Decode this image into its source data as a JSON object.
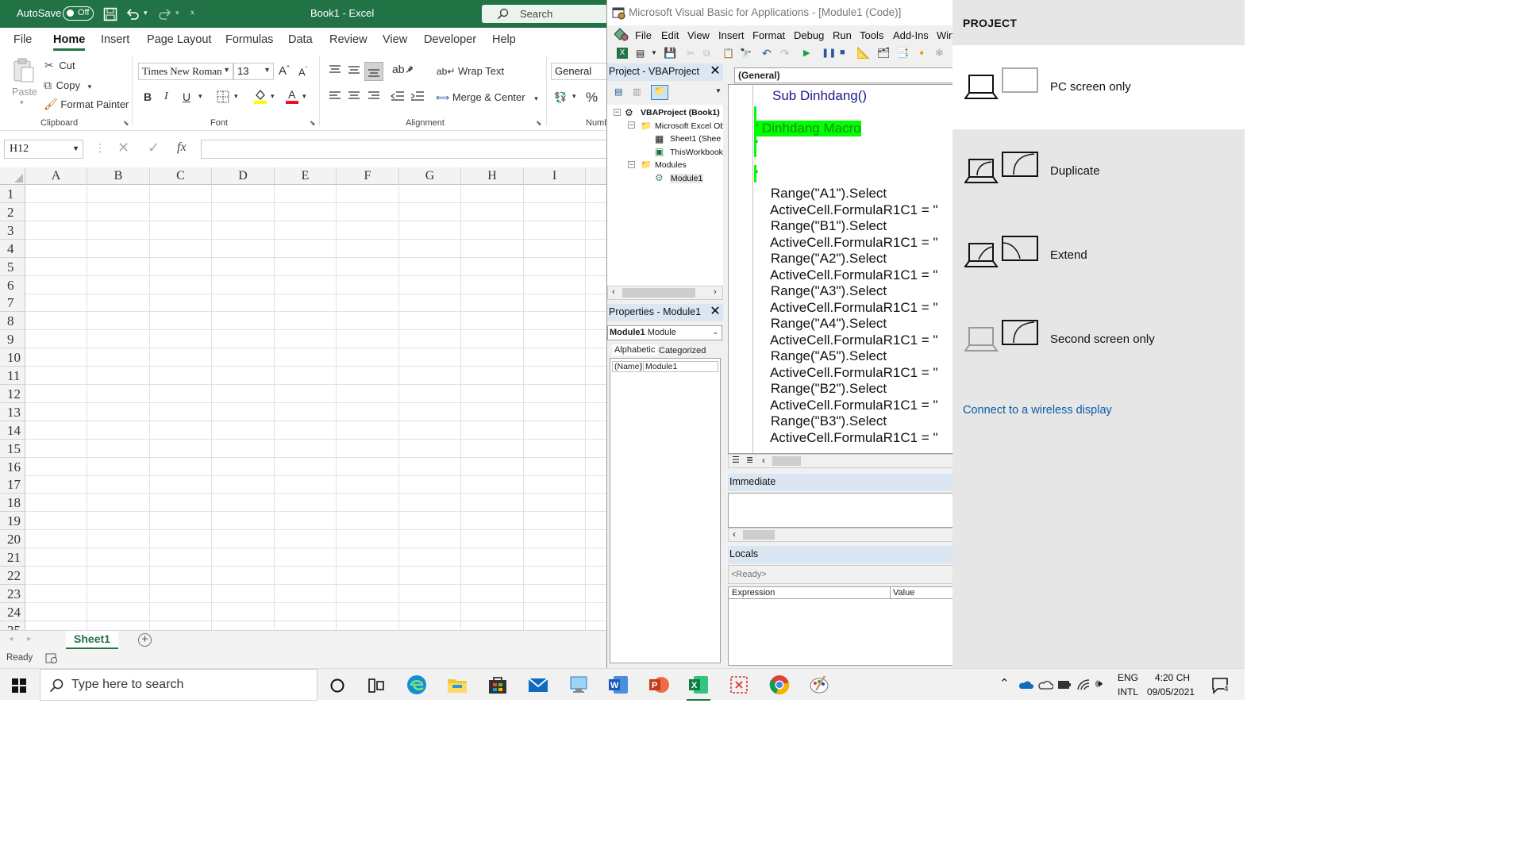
{
  "excel": {
    "title_bar": {
      "autosave_label": "AutoSave",
      "autosave_state": "Off",
      "doc_title": "Book1  -  Excel",
      "search_placeholder": "Search"
    },
    "menu_tabs": [
      "File",
      "Home",
      "Insert",
      "Page Layout",
      "Formulas",
      "Data",
      "Review",
      "View",
      "Developer",
      "Help"
    ],
    "active_tab": "Home",
    "ribbon": {
      "clipboard": {
        "paste": "Paste",
        "cut": "Cut",
        "copy": "Copy",
        "format_painter": "Format Painter",
        "group_label": "Clipboard"
      },
      "font": {
        "font_name": "Times New Roman",
        "font_size": "13",
        "bold": "B",
        "italic": "I",
        "underline": "U",
        "group_label": "Font"
      },
      "alignment": {
        "wrap_text": "Wrap Text",
        "merge_center": "Merge & Center",
        "group_label": "Alignment"
      },
      "number": {
        "format": "General",
        "group_label": "Numb",
        "percent": "%"
      }
    },
    "formula_bar": {
      "name_box": "H12",
      "fx": "fx",
      "formula": ""
    },
    "columns": [
      "A",
      "B",
      "C",
      "D",
      "E",
      "F",
      "G",
      "H",
      "I"
    ],
    "rows": [
      "1",
      "2",
      "3",
      "4",
      "5",
      "6",
      "7",
      "8",
      "9",
      "10",
      "11",
      "12",
      "13",
      "14",
      "15",
      "16",
      "17",
      "18",
      "19",
      "20",
      "21",
      "22",
      "23",
      "24",
      "25"
    ],
    "sheet_tab": "Sheet1",
    "status": "Ready"
  },
  "vba": {
    "title": "Microsoft Visual Basic for Applications - [Module1 (Code)]",
    "menu": [
      "File",
      "Edit",
      "View",
      "Insert",
      "Format",
      "Debug",
      "Run",
      "Tools",
      "Add-Ins",
      "Win"
    ],
    "project_pane_title": "Project - VBAProject",
    "tree": {
      "root": "VBAProject (Book1)",
      "excel_objects": "Microsoft Excel Ob",
      "sheet1": "Sheet1 (Shee",
      "thisworkbook": "ThisWorkbook",
      "modules": "Modules",
      "module1": "Module1"
    },
    "properties_title": "Properties - Module1",
    "properties_object": "Module1",
    "properties_type": "Module",
    "prop_tabs": [
      "Alphabetic",
      "Categorized"
    ],
    "prop_name_key": "(Name)",
    "prop_name_val": "Module1",
    "code_combo": "(General)",
    "code_lines": [
      "Sub Dinhdang()",
      "' Dinhdang Macro",
      "'",
      "'",
      "    Range(\"A1\").Select",
      "    ActiveCell.FormulaR1C1 = \"",
      "    Range(\"B1\").Select",
      "    ActiveCell.FormulaR1C1 = \"",
      "    Range(\"A2\").Select",
      "    ActiveCell.FormulaR1C1 = \"",
      "    Range(\"A3\").Select",
      "    ActiveCell.FormulaR1C1 = \"",
      "    Range(\"A4\").Select",
      "    ActiveCell.FormulaR1C1 = \"",
      "    Range(\"A5\").Select",
      "    ActiveCell.FormulaR1C1 = \"",
      "    Range(\"B2\").Select",
      "    ActiveCell.FormulaR1C1 = \"",
      "    Range(\"B3\").Select",
      "    ActiveCell.FormulaR1C1 = \""
    ],
    "immediate_title": "Immediate",
    "locals_title": "Locals",
    "locals_status": "<Ready>",
    "locals_cols": [
      "Expression",
      "Value"
    ],
    "highlight_color": "#00ff00"
  },
  "project_panel": {
    "heading": "PROJECT",
    "options": [
      "PC screen only",
      "Duplicate",
      "Extend",
      "Second screen only"
    ],
    "selected": "PC screen only",
    "connect_link": "Connect to a wireless display"
  },
  "taskbar": {
    "search_placeholder": "Type here to search",
    "lang_top": "ENG",
    "lang_bottom": "INTL",
    "time": "4:20 CH",
    "date": "09/05/2021",
    "notification_count": "4"
  }
}
